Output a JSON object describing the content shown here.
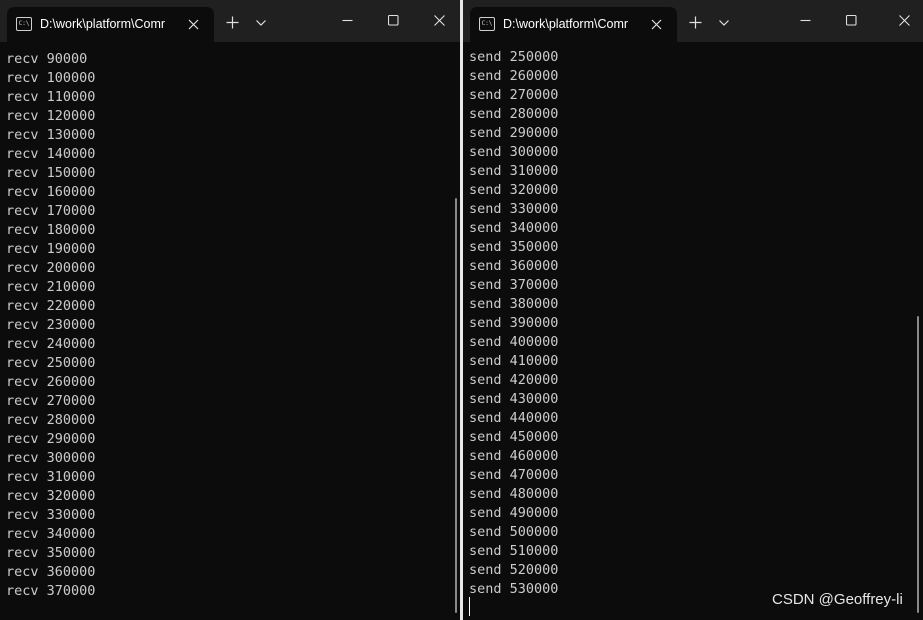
{
  "windows": {
    "left": {
      "tab_title": "D:\\work\\platform\\Comr",
      "tab_icon": "terminal-icon",
      "lines": [
        "recv 90000",
        "recv 100000",
        "recv 110000",
        "recv 120000",
        "recv 130000",
        "recv 140000",
        "recv 150000",
        "recv 160000",
        "recv 170000",
        "recv 180000",
        "recv 190000",
        "recv 200000",
        "recv 210000",
        "recv 220000",
        "recv 230000",
        "recv 240000",
        "recv 250000",
        "recv 260000",
        "recv 270000",
        "recv 280000",
        "recv 290000",
        "recv 300000",
        "recv 310000",
        "recv 320000",
        "recv 330000",
        "recv 340000",
        "recv 350000",
        "recv 360000",
        "recv 370000"
      ]
    },
    "right": {
      "tab_title": "D:\\work\\platform\\Comr",
      "tab_icon": "terminal-icon",
      "lines": [
        "send 250000",
        "send 260000",
        "send 270000",
        "send 280000",
        "send 290000",
        "send 300000",
        "send 310000",
        "send 320000",
        "send 330000",
        "send 340000",
        "send 350000",
        "send 360000",
        "send 370000",
        "send 380000",
        "send 390000",
        "send 400000",
        "send 410000",
        "send 420000",
        "send 430000",
        "send 440000",
        "send 450000",
        "send 460000",
        "send 470000",
        "send 480000",
        "send 490000",
        "send 500000",
        "send 510000",
        "send 520000",
        "send 530000"
      ]
    }
  },
  "icons": {
    "new_tab": "plus-icon",
    "dropdown": "chevron-down-icon",
    "minimize": "minimize-icon",
    "maximize": "maximize-icon",
    "close": "close-icon"
  },
  "watermark": "CSDN @Geoffrey-li",
  "colors": {
    "console_bg": "#0c0c0c",
    "titlebar_bg": "#202020",
    "console_text": "#cccccc"
  }
}
